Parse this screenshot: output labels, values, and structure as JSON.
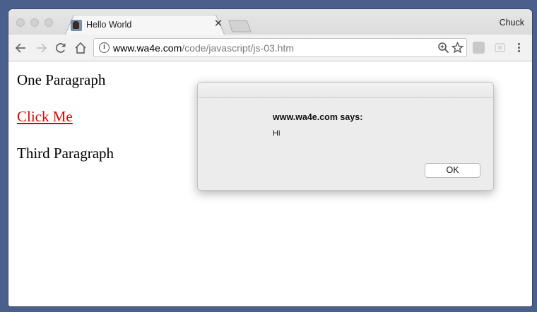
{
  "browser": {
    "tab": {
      "title": "Hello World",
      "favicon": "avatar-favicon"
    },
    "profile_name": "Chuck",
    "address": {
      "host": "www.wa4e.com",
      "path": "/code/javascript/js-03.htm"
    }
  },
  "page": {
    "paragraph_1": "One Paragraph",
    "link_text": "Click Me",
    "paragraph_3": "Third Paragraph",
    "link_color": "#e00000"
  },
  "alert": {
    "title": "www.wa4e.com says:",
    "message": "Hi",
    "ok_label": "OK"
  },
  "colors": {
    "desktop": "#4a5f8c",
    "toolbar": "#f2f2f2",
    "dialog": "#ececec"
  }
}
